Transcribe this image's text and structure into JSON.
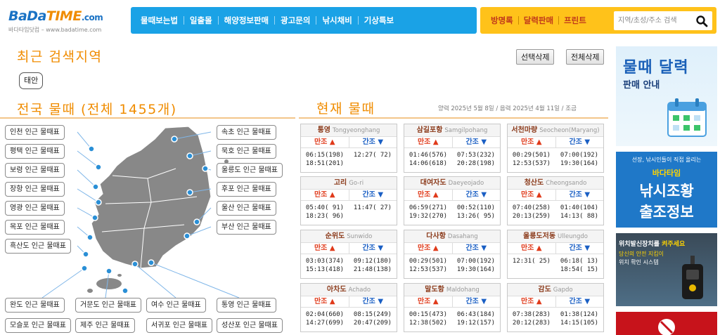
{
  "header": {
    "logo": {
      "main_ba": "BaDa",
      "main_time": "TIME",
      "domain": ".com",
      "sub": "바다타임닷컴 – www.badatime.com"
    },
    "nav": [
      "물때보는법",
      "일출몰",
      "해양정보판매",
      "광고문의",
      "낚시채비",
      "기상특보"
    ],
    "top_links": [
      "방명록",
      "달력판매",
      "프린트"
    ],
    "search": {
      "placeholder": "지역/초성/주소 검색",
      "value": ""
    }
  },
  "recent": {
    "title": "최근 검색지역",
    "select_delete": "선택삭제",
    "all_delete": "전체삭제",
    "chips": [
      "태안"
    ]
  },
  "national": {
    "title": "전국 물때 (전체 1455개)",
    "left_buttons": [
      "인천 인근 물때표",
      "평택 인근 물때표",
      "보령 인근 물때표",
      "장항 인근 물때표",
      "영광 인근 물때표",
      "목포 인근 물때표",
      "흑산도 인근 물때표"
    ],
    "right_buttons": [
      "속초 인근 물때표",
      "묵호 인근 물때표",
      "울릉도 인근 물때표",
      "후포 인근 물때표",
      "울산 인근 물때표",
      "부산 인근 물때표"
    ],
    "bottom_row1": [
      "완도 인근 물때표",
      "거문도 인근 물때표",
      "여수 인근 물때표",
      "통영 인근 물때표"
    ],
    "bottom_row2": [
      "모슬포 인근 물때표",
      "제주 인근 물때표",
      "서귀포 인근 물때표",
      "성산포 인근 물때표"
    ]
  },
  "current": {
    "title": "현재 물때",
    "date_line": "양력 2025년 5월 8일 / 음력 2025년 4월 11일 / 조금",
    "high_label": "만조",
    "low_label": "간조",
    "stations": [
      {
        "name": "통영",
        "en": "Tongyeonghang",
        "high": [
          "06:15(198)",
          "18:51(201)"
        ],
        "low": [
          "12:27( 72)",
          ""
        ]
      },
      {
        "name": "삼길포항",
        "en": "Samgilpohang",
        "high": [
          "01:46(576)",
          "14:06(618)"
        ],
        "low": [
          "07:53(232)",
          "20:28(198)"
        ]
      },
      {
        "name": "서천마량",
        "en": "Seocheon(Maryang)",
        "high": [
          "00:29(501)",
          "12:53(537)"
        ],
        "low": [
          "07:00(192)",
          "19:30(164)"
        ]
      },
      {
        "name": "고리",
        "en": "Go-ri",
        "high": [
          "05:40( 91)",
          "18:23( 96)"
        ],
        "low": [
          "11:47( 27)",
          ""
        ]
      },
      {
        "name": "대여자도",
        "en": "Daeyeojado",
        "high": [
          "06:59(271)",
          "19:32(270)"
        ],
        "low": [
          "00:52(110)",
          "13:26( 95)"
        ]
      },
      {
        "name": "청산도",
        "en": "Cheongsando",
        "high": [
          "07:40(258)",
          "20:13(259)"
        ],
        "low": [
          "01:40(104)",
          "14:13( 88)"
        ]
      },
      {
        "name": "순위도",
        "en": "Sunwido",
        "high": [
          "03:03(374)",
          "15:13(418)"
        ],
        "low": [
          "09:12(180)",
          "21:48(138)"
        ]
      },
      {
        "name": "다사항",
        "en": "Dasahang",
        "high": [
          "00:29(501)",
          "12:53(537)"
        ],
        "low": [
          "07:00(192)",
          "19:30(164)"
        ]
      },
      {
        "name": "울릉도저동",
        "en": "Ulleungdo",
        "high": [
          "12:31( 25)",
          ""
        ],
        "low": [
          "06:18( 13)",
          "18:54( 15)"
        ]
      },
      {
        "name": "아차도",
        "en": "Achado",
        "high": [
          "02:04(660)",
          "14:27(699)"
        ],
        "low": [
          "08:15(249)",
          "20:47(209)"
        ]
      },
      {
        "name": "말도항",
        "en": "Maldohang",
        "high": [
          "00:15(473)",
          "12:38(502)"
        ],
        "low": [
          "06:43(184)",
          "19:12(157)"
        ]
      },
      {
        "name": "감도",
        "en": "Gapdo",
        "high": [
          "07:38(283)",
          "20:12(283)"
        ],
        "low": [
          "01:38(124)",
          "14:15(105)"
        ]
      }
    ]
  },
  "banners": {
    "b1_title": "물때 달력",
    "b1_sub": "판매 안내",
    "b2_top": "선장, 낚시인들이 직접 올리는",
    "b2_brand": "바다타임",
    "b2_line1": "낚시조황",
    "b2_line2": "출조정보",
    "b3_line1": "위치발신장치를",
    "b3_line1b": "켜주세요",
    "b3_line2": "당신의 안전 지킴이",
    "b3_line3": "위치 확인 시스템"
  },
  "colors": {
    "nav_bg": "#1aa2e6",
    "topright_bg": "#ffc21a",
    "title_orange": "#f08c00",
    "high_red": "#e03a1a",
    "low_blue": "#1a5fc4"
  }
}
